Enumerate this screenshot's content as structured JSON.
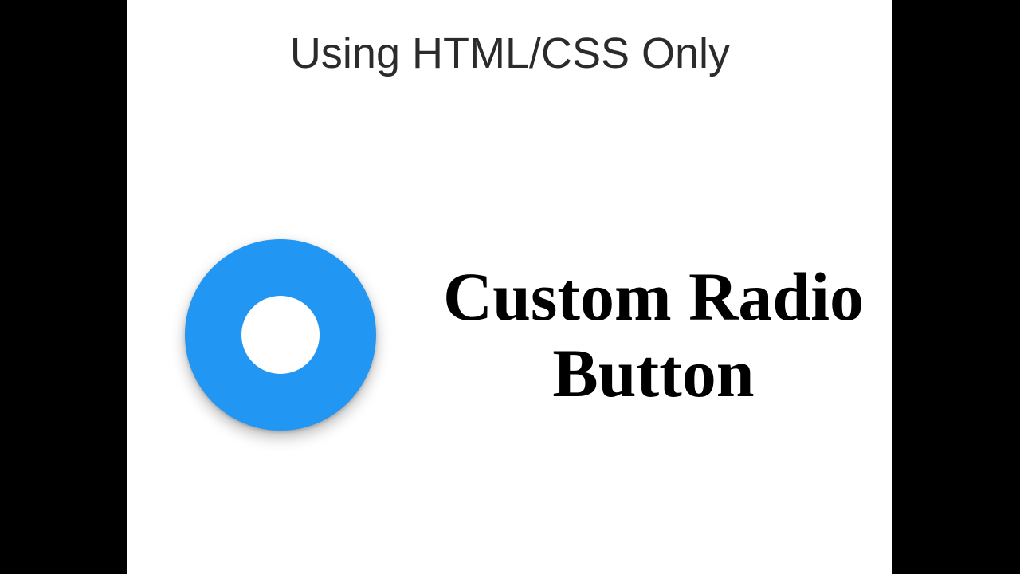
{
  "heading": "Using HTML/CSS Only",
  "title": "Custom Radio Button",
  "accent_color": "#2196F3"
}
